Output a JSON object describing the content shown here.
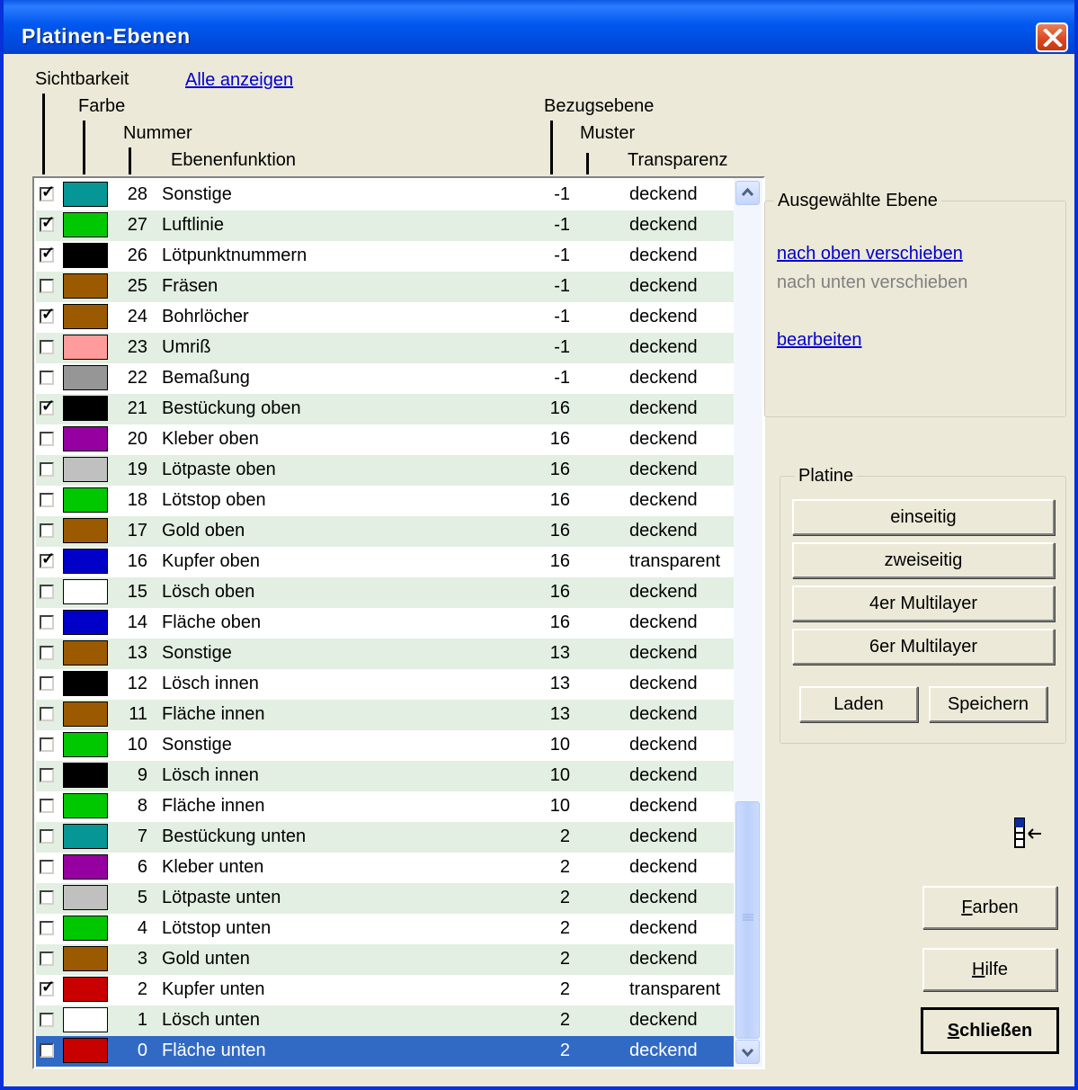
{
  "window": {
    "title": "Platinen-Ebenen"
  },
  "header": {
    "visibility": "Sichtbarkeit",
    "show_all": "Alle anzeigen",
    "color": "Farbe",
    "number": "Nummer",
    "function": "Ebenenfunktion",
    "reference": "Bezugsebene",
    "pattern": "Muster",
    "transparency": "Transparenz"
  },
  "layers": [
    {
      "visible": true,
      "color": "#069696",
      "number": "28",
      "name": "Sonstige",
      "ref": "-1",
      "transparency": "deckend"
    },
    {
      "visible": true,
      "color": "#00c800",
      "number": "27",
      "name": "Luftlinie",
      "ref": "-1",
      "transparency": "deckend"
    },
    {
      "visible": true,
      "color": "#000000",
      "number": "26",
      "name": "Lötpunktnummern",
      "ref": "-1",
      "transparency": "deckend"
    },
    {
      "visible": false,
      "color": "#9b5a00",
      "number": "25",
      "name": "Fräsen",
      "ref": "-1",
      "transparency": "deckend"
    },
    {
      "visible": true,
      "color": "#9b5a00",
      "number": "24",
      "name": "Bohrlöcher",
      "ref": "-1",
      "transparency": "deckend"
    },
    {
      "visible": false,
      "color": "#ff9b9b",
      "number": "23",
      "name": "Umriß",
      "ref": "-1",
      "transparency": "deckend"
    },
    {
      "visible": false,
      "color": "#969696",
      "number": "22",
      "name": "Bemaßung",
      "ref": "-1",
      "transparency": "deckend"
    },
    {
      "visible": true,
      "color": "#000000",
      "number": "21",
      "name": "Bestückung oben",
      "ref": "16",
      "transparency": "deckend"
    },
    {
      "visible": false,
      "color": "#9600a0",
      "number": "20",
      "name": "Kleber oben",
      "ref": "16",
      "transparency": "deckend"
    },
    {
      "visible": false,
      "color": "#c0c0c0",
      "number": "19",
      "name": "Lötpaste oben",
      "ref": "16",
      "transparency": "deckend"
    },
    {
      "visible": false,
      "color": "#00c800",
      "number": "18",
      "name": "Lötstop oben",
      "ref": "16",
      "transparency": "deckend"
    },
    {
      "visible": false,
      "color": "#9b5a00",
      "number": "17",
      "name": "Gold oben",
      "ref": "16",
      "transparency": "deckend"
    },
    {
      "visible": true,
      "color": "#0000c8",
      "number": "16",
      "name": "Kupfer oben",
      "ref": "16",
      "transparency": "transparent"
    },
    {
      "visible": false,
      "color": "#ffffff",
      "number": "15",
      "name": "Lösch oben",
      "ref": "16",
      "transparency": "deckend"
    },
    {
      "visible": false,
      "color": "#0000c8",
      "number": "14",
      "name": "Fläche oben",
      "ref": "16",
      "transparency": "deckend"
    },
    {
      "visible": false,
      "color": "#9b5a00",
      "number": "13",
      "name": "Sonstige",
      "ref": "13",
      "transparency": "deckend"
    },
    {
      "visible": false,
      "color": "#000000",
      "number": "12",
      "name": "Lösch innen",
      "ref": "13",
      "transparency": "deckend"
    },
    {
      "visible": false,
      "color": "#9b5a00",
      "number": "11",
      "name": "Fläche innen",
      "ref": "13",
      "transparency": "deckend"
    },
    {
      "visible": false,
      "color": "#00c800",
      "number": "10",
      "name": "Sonstige",
      "ref": "10",
      "transparency": "deckend"
    },
    {
      "visible": false,
      "color": "#000000",
      "number": "9",
      "name": "Lösch innen",
      "ref": "10",
      "transparency": "deckend"
    },
    {
      "visible": false,
      "color": "#00c800",
      "number": "8",
      "name": "Fläche innen",
      "ref": "10",
      "transparency": "deckend"
    },
    {
      "visible": false,
      "color": "#069696",
      "number": "7",
      "name": "Bestückung unten",
      "ref": "2",
      "transparency": "deckend"
    },
    {
      "visible": false,
      "color": "#9600a0",
      "number": "6",
      "name": "Kleber unten",
      "ref": "2",
      "transparency": "deckend"
    },
    {
      "visible": false,
      "color": "#c0c0c0",
      "number": "5",
      "name": "Lötpaste unten",
      "ref": "2",
      "transparency": "deckend"
    },
    {
      "visible": false,
      "color": "#00c800",
      "number": "4",
      "name": "Lötstop unten",
      "ref": "2",
      "transparency": "deckend"
    },
    {
      "visible": false,
      "color": "#9b5a00",
      "number": "3",
      "name": "Gold unten",
      "ref": "2",
      "transparency": "deckend"
    },
    {
      "visible": true,
      "color": "#c80000",
      "number": "2",
      "name": "Kupfer unten",
      "ref": "2",
      "transparency": "transparent"
    },
    {
      "visible": false,
      "color": "#ffffff",
      "number": "1",
      "name": "Lösch unten",
      "ref": "2",
      "transparency": "deckend"
    },
    {
      "visible": false,
      "color": "#c80000",
      "number": "0",
      "name": "Fläche unten",
      "ref": "2",
      "transparency": "deckend",
      "selected": true
    }
  ],
  "selected_layer": {
    "group_label": "Ausgewählte Ebene",
    "move_up": "nach oben verschieben",
    "move_down": "nach unten verschieben",
    "edit": "bearbeiten"
  },
  "board": {
    "group_label": "Platine",
    "single_sided": "einseitig",
    "double_sided": "zweiseitig",
    "multilayer4": "4er Multilayer",
    "multilayer6": "6er Multilayer",
    "load": "Laden",
    "save": "Speichern"
  },
  "buttons": {
    "colors_accel": "F",
    "colors_rest": "arben",
    "help_accel": "H",
    "help_rest": "ilfe",
    "close_accel": "S",
    "close_rest": "chließen"
  },
  "icons": {
    "close": "close-icon",
    "collapse": "collapse-panel-icon",
    "scroll_up": "scroll-up-icon",
    "scroll_down": "scroll-down-icon"
  }
}
